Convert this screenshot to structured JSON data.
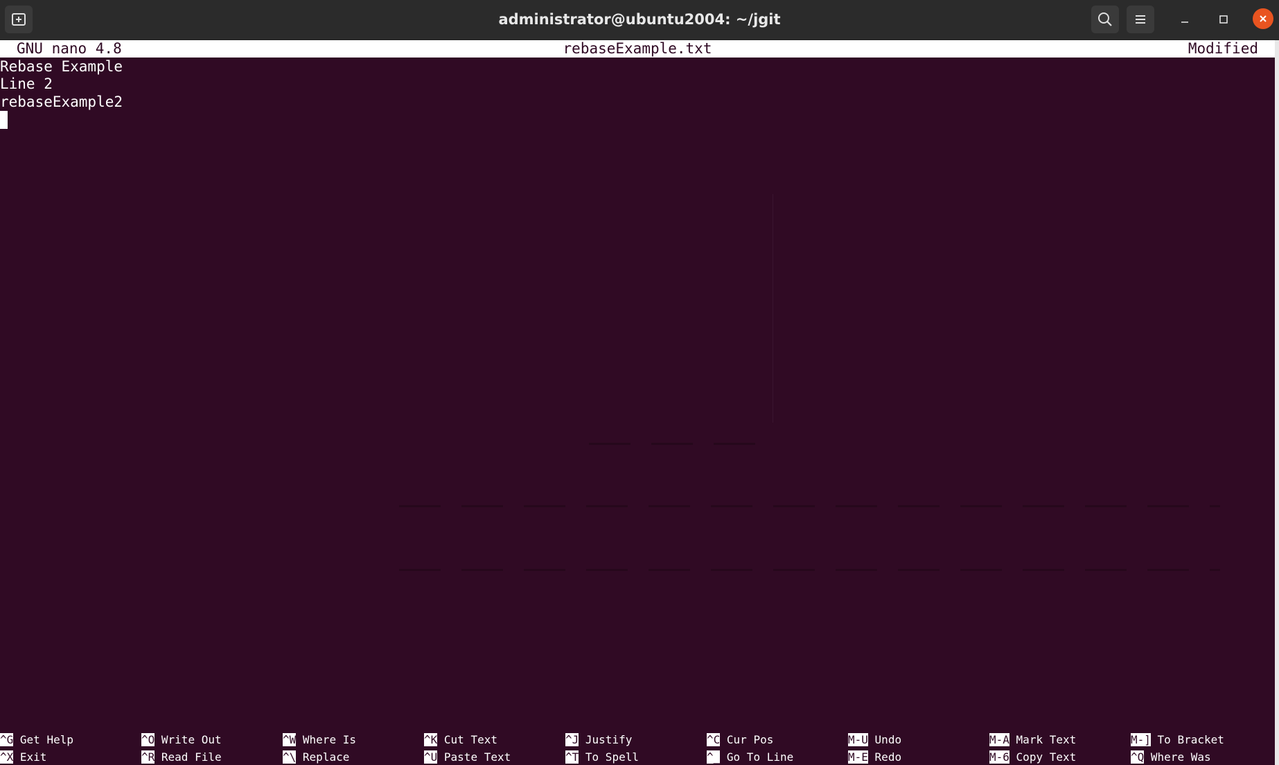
{
  "window": {
    "title": "administrator@ubuntu2004: ~/jgit"
  },
  "titlebar_icons": {
    "new_tab": "new-tab-icon",
    "search": "search-icon",
    "menu": "hamburger-menu-icon",
    "minimize": "minimize-icon",
    "maximize": "maximize-icon",
    "close": "close-icon"
  },
  "colors": {
    "terminal_bg": "#300a24",
    "titlebar_bg": "#2b2b2b",
    "close_accent": "#e95420",
    "text": "#ffffff"
  },
  "nano": {
    "version": "GNU nano 4.8",
    "filename": "rebaseExample.txt",
    "status": "Modified"
  },
  "editor": {
    "lines": [
      "Rebase Example",
      "Line 2",
      "rebaseExample2",
      ""
    ]
  },
  "shortcuts": {
    "row1": [
      {
        "key": "^G",
        "label": "Get Help"
      },
      {
        "key": "^O",
        "label": "Write Out"
      },
      {
        "key": "^W",
        "label": "Where Is"
      },
      {
        "key": "^K",
        "label": "Cut Text"
      },
      {
        "key": "^J",
        "label": "Justify"
      },
      {
        "key": "^C",
        "label": "Cur Pos"
      },
      {
        "key": "M-U",
        "label": "Undo"
      },
      {
        "key": "M-A",
        "label": "Mark Text"
      },
      {
        "key": "M-]",
        "label": "To Bracket"
      }
    ],
    "row2": [
      {
        "key": "^X",
        "label": "Exit"
      },
      {
        "key": "^R",
        "label": "Read File"
      },
      {
        "key": "^\\",
        "label": "Replace"
      },
      {
        "key": "^U",
        "label": "Paste Text"
      },
      {
        "key": "^T",
        "label": "To Spell"
      },
      {
        "key": "^_",
        "label": "Go To Line"
      },
      {
        "key": "M-E",
        "label": "Redo"
      },
      {
        "key": "M-6",
        "label": "Copy Text"
      },
      {
        "key": "^Q",
        "label": "Where Was"
      }
    ]
  }
}
